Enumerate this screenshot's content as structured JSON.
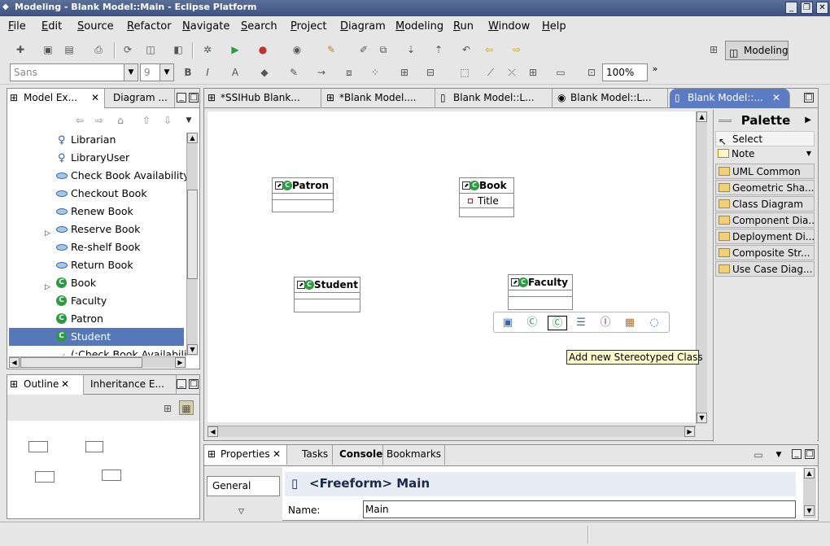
{
  "window": {
    "title": "Modeling - Blank Model::Main - Eclipse Platform"
  },
  "menu": [
    "File",
    "Edit",
    "Source",
    "Refactor",
    "Navigate",
    "Search",
    "Project",
    "Diagram",
    "Modeling",
    "Run",
    "Window",
    "Help"
  ],
  "toolbar": {
    "font_name": "Sans",
    "font_size": "9",
    "zoom": "100%",
    "perspective": "Modeling"
  },
  "model_explorer": {
    "tabs": [
      "Model Ex...",
      "Diagram ..."
    ],
    "items": [
      {
        "label": "Librarian",
        "icon": "actor-icon",
        "expand": ""
      },
      {
        "label": "LibraryUser",
        "icon": "actor-icon",
        "expand": ""
      },
      {
        "label": "Check Book Availability",
        "icon": "usecase-icon",
        "expand": ""
      },
      {
        "label": "Checkout Book",
        "icon": "usecase-icon",
        "expand": ""
      },
      {
        "label": "Renew Book",
        "icon": "usecase-icon",
        "expand": ""
      },
      {
        "label": "Reserve Book",
        "icon": "usecase-icon",
        "expand": "▷"
      },
      {
        "label": "Re-shelf Book",
        "icon": "usecase-icon",
        "expand": ""
      },
      {
        "label": "Return Book",
        "icon": "usecase-icon",
        "expand": ""
      },
      {
        "label": "Book",
        "icon": "class-icon",
        "expand": "▷"
      },
      {
        "label": "Faculty",
        "icon": "class-icon",
        "expand": ""
      },
      {
        "label": "Patron",
        "icon": "class-icon",
        "expand": ""
      },
      {
        "label": "Student",
        "icon": "class-icon",
        "expand": ""
      },
      {
        "label": "(:Check Book Availabilit",
        "icon": "association-icon",
        "expand": "▷"
      }
    ],
    "selected": "Student"
  },
  "outline": {
    "tabs": [
      "Outline",
      "Inheritance E..."
    ]
  },
  "editor": {
    "tabs": [
      "*SSIHub Blank...",
      "*Blank Model....",
      "Blank Model::L...",
      "Blank Model::L...",
      "Blank Model::..."
    ],
    "classes": [
      {
        "name": "Patron",
        "attrs": []
      },
      {
        "name": "Book",
        "attrs": [
          "Title"
        ]
      },
      {
        "name": "Student",
        "attrs": []
      },
      {
        "name": "Faculty",
        "attrs": []
      }
    ],
    "tooltip": "Add new Stereotyped Class"
  },
  "palette": {
    "title": "Palette",
    "tools": [
      "Select",
      "Note"
    ],
    "drawers": [
      "UML Common",
      "Geometric Sha...",
      "Class Diagram",
      "Component Dia...",
      "Deployment Di...",
      "Composite Str...",
      "Use Case Diag..."
    ]
  },
  "properties": {
    "tabs": [
      "Properties",
      "Tasks",
      "Console",
      "Bookmarks"
    ],
    "section": "General",
    "title": "<Freeform> Main",
    "name_label": "Name:",
    "name_value": "Main"
  }
}
